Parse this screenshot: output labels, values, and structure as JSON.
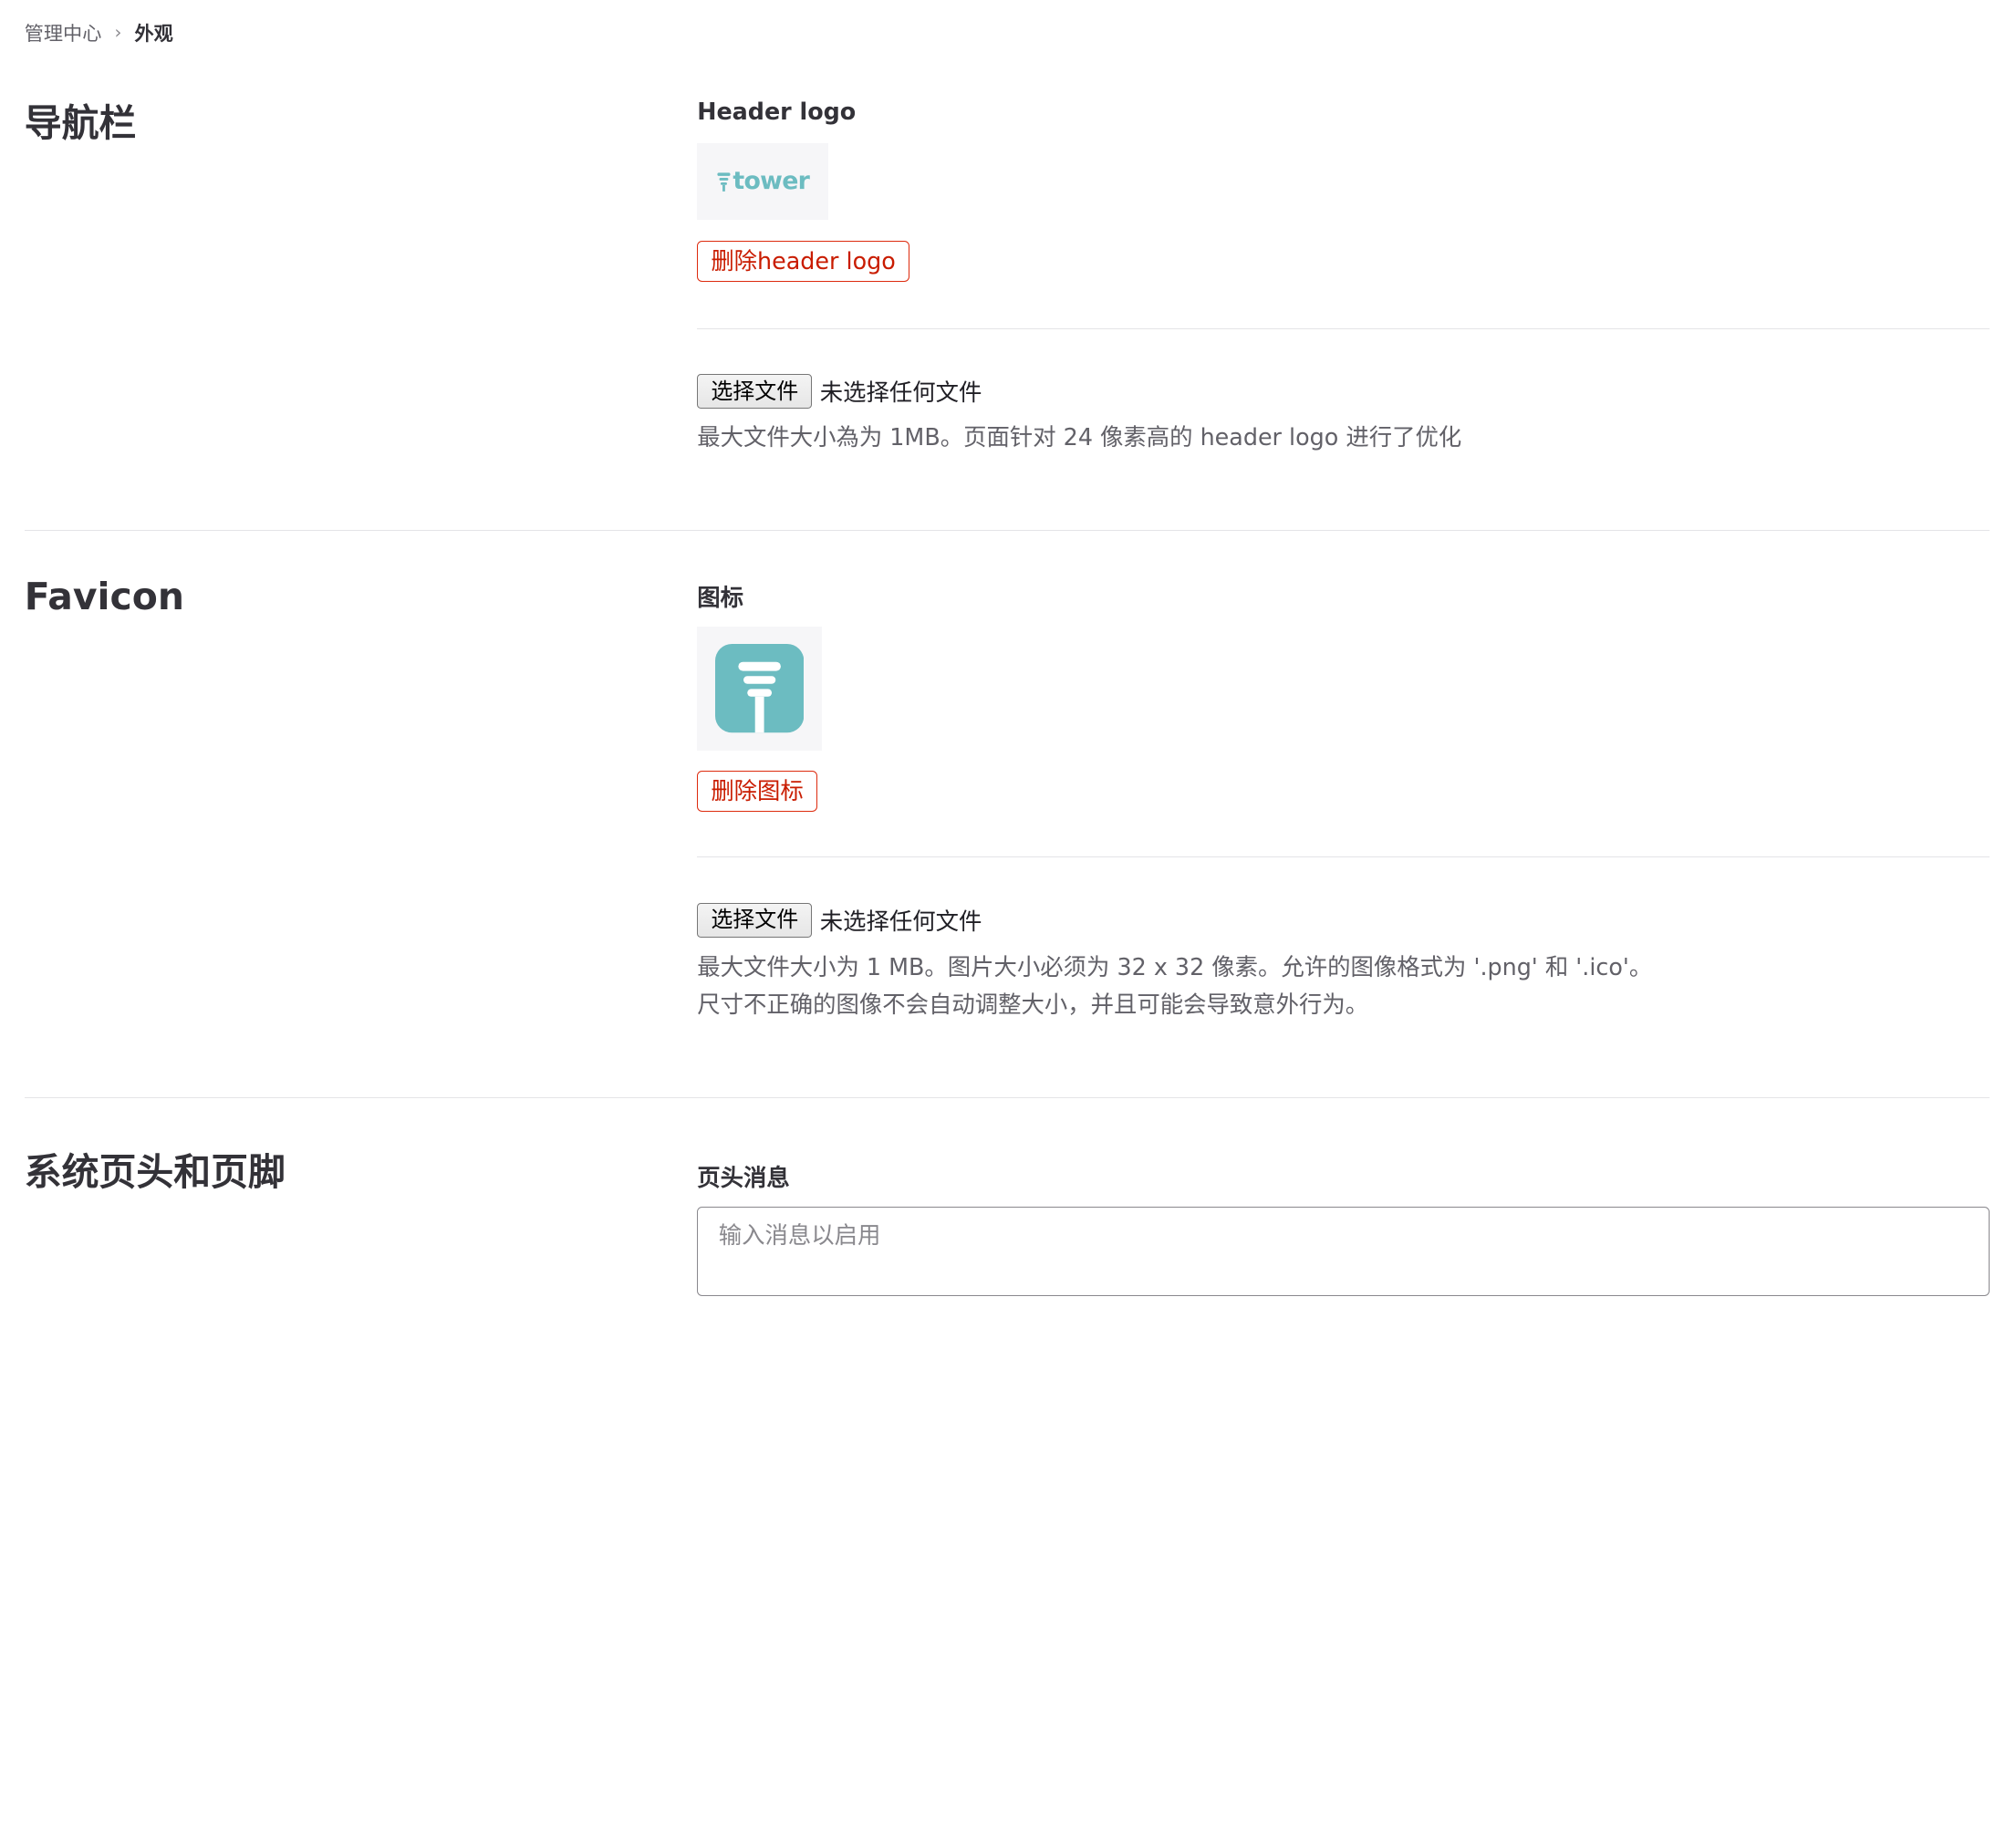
{
  "breadcrumb": {
    "parent": "管理中心",
    "separator": "›",
    "current": "外观"
  },
  "navbar_section": {
    "title": "导航栏",
    "field_label": "Header logo",
    "logo_text": "tower",
    "delete_button": "删除header logo",
    "choose_file": "选择文件",
    "no_file": "未选择任何文件",
    "help": "最大文件大小為为 1MB。页面针对 24 像素高的 header logo 进行了优化"
  },
  "favicon_section": {
    "title": "Favicon",
    "field_label": "图标",
    "delete_button": "删除图标",
    "choose_file": "选择文件",
    "no_file": "未选择任何文件",
    "help_line1": "最大文件大小为 1 MB。图片大小必须为 32 x 32 像素。允许的图像格式为 '.png' 和 '.ico'。",
    "help_line2": "尺寸不正确的图像不会自动调整大小，并且可能会导致意外行为。"
  },
  "system_section": {
    "title": "系统页头和页脚",
    "field_label": "页头消息",
    "placeholder": "输入消息以启用"
  },
  "colors": {
    "brand_teal": "#6cbcc1",
    "danger": "#dd2b0e"
  }
}
